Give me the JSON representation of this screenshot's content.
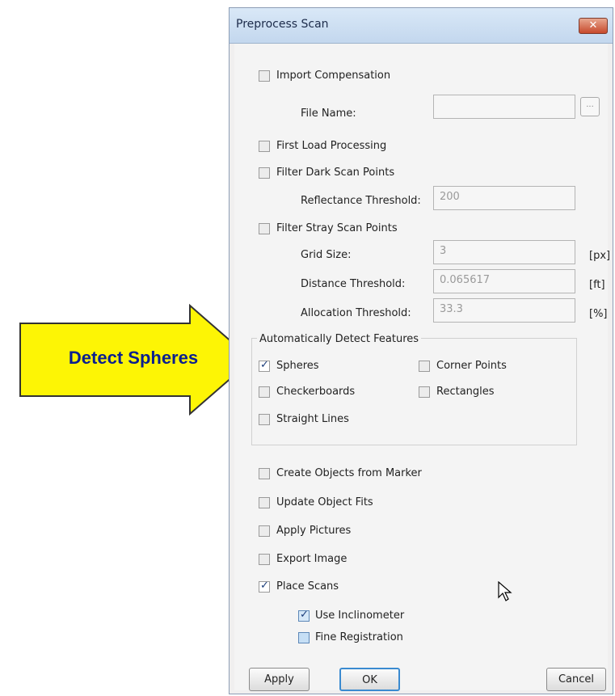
{
  "annotation": {
    "label": "Detect Spheres",
    "arrow_color": "#fdf505"
  },
  "dialog": {
    "title": "Preprocess Scan",
    "close_glyph": "✕",
    "import_compensation": {
      "label": "Import Compensation",
      "checked": false
    },
    "file_name": {
      "label": "File Name:",
      "value": "",
      "browse": "..."
    },
    "first_load": {
      "label": "First Load Processing",
      "checked": false
    },
    "filter_dark": {
      "label": "Filter Dark Scan Points",
      "checked": false
    },
    "reflectance": {
      "label": "Reflectance Threshold:",
      "value": "200"
    },
    "filter_stray": {
      "label": "Filter Stray Scan Points",
      "checked": false
    },
    "grid_size": {
      "label": "Grid Size:",
      "value": "3",
      "unit": "[px]"
    },
    "distance": {
      "label": "Distance Threshold:",
      "value": "0.065617",
      "unit": "[ft]"
    },
    "allocation": {
      "label": "Allocation Threshold:",
      "value": "33.3",
      "unit": "[%]"
    },
    "detect_group": {
      "title": "Automatically Detect Features",
      "spheres": {
        "label": "Spheres",
        "checked": true
      },
      "corner_points": {
        "label": "Corner Points",
        "checked": false
      },
      "checkerboards": {
        "label": "Checkerboards",
        "checked": false
      },
      "rectangles": {
        "label": "Rectangles",
        "checked": false
      },
      "straight_lines": {
        "label": "Straight Lines",
        "checked": false
      }
    },
    "create_objects": {
      "label": "Create Objects from Marker",
      "checked": false
    },
    "update_fits": {
      "label": "Update Object Fits",
      "checked": false
    },
    "apply_pictures": {
      "label": "Apply Pictures",
      "checked": false
    },
    "export_image": {
      "label": "Export Image",
      "checked": false
    },
    "place_scans": {
      "label": "Place Scans",
      "checked": true
    },
    "use_inclinometer": {
      "label": "Use Inclinometer",
      "checked": true
    },
    "fine_registration": {
      "label": "Fine Registration",
      "checked": false
    },
    "buttons": {
      "apply": "Apply",
      "ok": "OK",
      "cancel": "Cancel"
    }
  }
}
